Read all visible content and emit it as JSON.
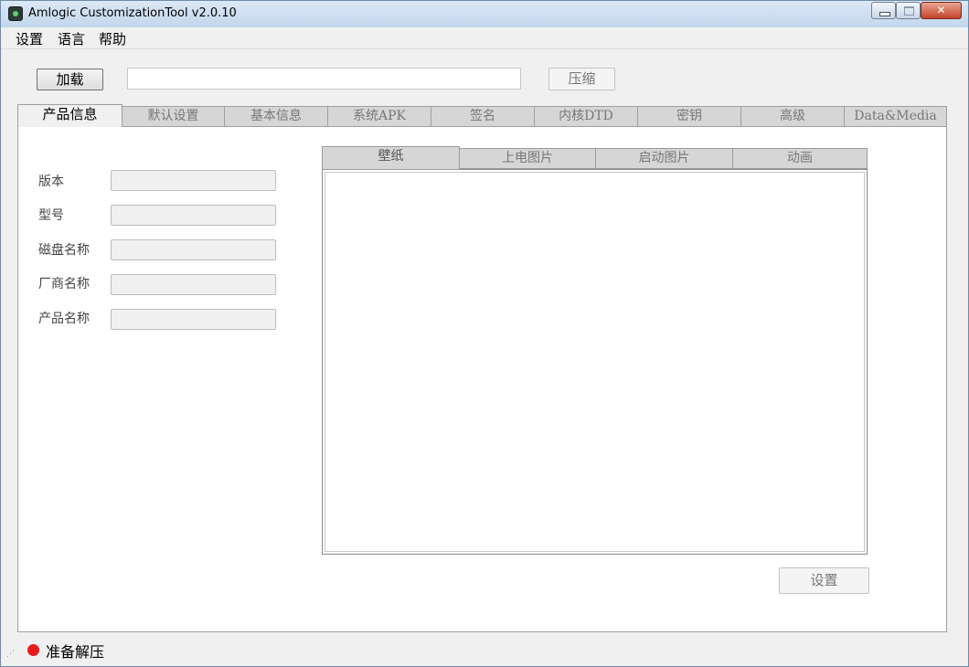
{
  "window": {
    "title": "Amlogic CustomizationTool v2.0.10",
    "close_glyph": "✕"
  },
  "menu": {
    "items": [
      {
        "label": "设置"
      },
      {
        "label": "语言"
      },
      {
        "label": "帮助"
      }
    ]
  },
  "toolbar": {
    "load_label": "加载",
    "path_value": "",
    "compress_label": "压缩"
  },
  "tabs": [
    {
      "label": "产品信息",
      "active": true
    },
    {
      "label": "默认设置",
      "active": false
    },
    {
      "label": "基本信息",
      "active": false
    },
    {
      "label": "系统APK",
      "active": false
    },
    {
      "label": "签名",
      "active": false
    },
    {
      "label": "内核DTD",
      "active": false
    },
    {
      "label": "密钥",
      "active": false
    },
    {
      "label": "高级",
      "active": false
    },
    {
      "label": "Data&Media",
      "active": false
    }
  ],
  "product_info": {
    "fields": [
      {
        "label": "版本",
        "value": ""
      },
      {
        "label": "型号",
        "value": ""
      },
      {
        "label": "磁盘名称",
        "value": ""
      },
      {
        "label": "厂商名称",
        "value": ""
      },
      {
        "label": "产品名称",
        "value": ""
      }
    ]
  },
  "image_tabs": [
    {
      "label": "壁纸",
      "active": true
    },
    {
      "label": "上电图片",
      "active": false
    },
    {
      "label": "启动图片",
      "active": false
    },
    {
      "label": "动画",
      "active": false
    }
  ],
  "actions": {
    "set_label": "设置"
  },
  "status": {
    "text": "准备解压",
    "indicator_color": "#e81c1c"
  },
  "icons": {
    "app": "amlogic-app-icon",
    "minimize": "minimize-icon",
    "maximize": "maximize-icon",
    "close": "close-icon",
    "status": "status-dot-icon",
    "grip": "resize-grip-icon"
  }
}
